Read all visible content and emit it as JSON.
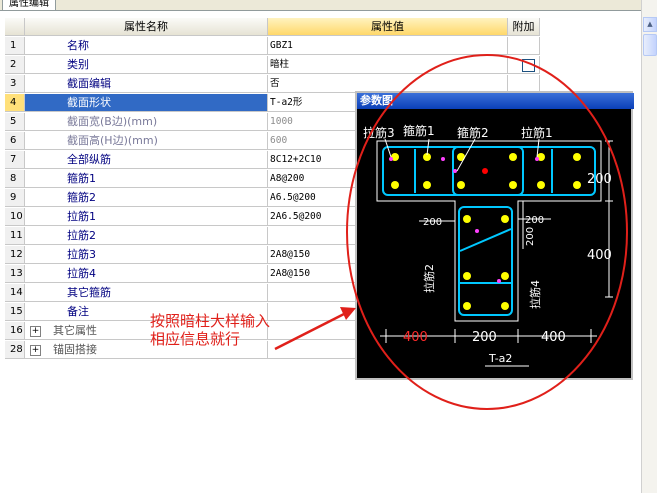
{
  "tab": {
    "label": "属性编辑"
  },
  "columns": {
    "name": "属性名称",
    "value": "属性值",
    "extra": "附加"
  },
  "rows": [
    {
      "num": "1",
      "name": "名称",
      "value": "GBZ1"
    },
    {
      "num": "2",
      "name": "类别",
      "value": "暗柱",
      "checkbox": true
    },
    {
      "num": "3",
      "name": "截面编辑",
      "value": "否"
    },
    {
      "num": "4",
      "name": "截面形状",
      "value": "T-a2形",
      "selected": true
    },
    {
      "num": "5",
      "name": "截面宽(B边)(mm)",
      "value": "1000",
      "dim": true
    },
    {
      "num": "6",
      "name": "截面高(H边)(mm)",
      "value": "600",
      "dim": true
    },
    {
      "num": "7",
      "name": "全部纵筋",
      "value": "8C12+2C10"
    },
    {
      "num": "8",
      "name": "箍筋1",
      "value": "A8@200"
    },
    {
      "num": "9",
      "name": "箍筋2",
      "value": "A6.5@200"
    },
    {
      "num": "10",
      "name": "拉筋1",
      "value": "2A6.5@200"
    },
    {
      "num": "11",
      "name": "拉筋2",
      "value": ""
    },
    {
      "num": "12",
      "name": "拉筋3",
      "value": "2A8@150"
    },
    {
      "num": "13",
      "name": "拉筋4",
      "value": "2A8@150"
    },
    {
      "num": "14",
      "name": "其它箍筋",
      "value": ""
    },
    {
      "num": "15",
      "name": "备注",
      "value": ""
    },
    {
      "num": "16",
      "name": "其它属性",
      "value": "",
      "group": true
    },
    {
      "num": "28",
      "name": "锚固搭接",
      "value": "",
      "group": true
    }
  ],
  "param_window": {
    "title": "参数图",
    "labels": {
      "tie3": "拉筋3",
      "stirrup1": "箍筋1",
      "stirrup2": "箍筋2",
      "tie1": "拉筋1",
      "tie2": "拉筋2",
      "tie4": "拉筋4",
      "dim_top_h": "200",
      "dim_side_h": "400",
      "dim_inner_w1": "200",
      "dim_inner_w2": "200",
      "dim_inner_h": "200",
      "dim_bottom_left": "400",
      "dim_bottom_mid": "200",
      "dim_bottom_right": "400",
      "shape_name": "T-a2"
    },
    "colors": {
      "bg": "#000000",
      "outline": "#ffffff",
      "rebar": "#ffff00",
      "stirrup": "#00c8ff",
      "accent": "#ff0000"
    }
  },
  "annotation": {
    "line1": "按照暗柱大样输入",
    "line2": "相应信息就行",
    "color": "#e0201a"
  }
}
